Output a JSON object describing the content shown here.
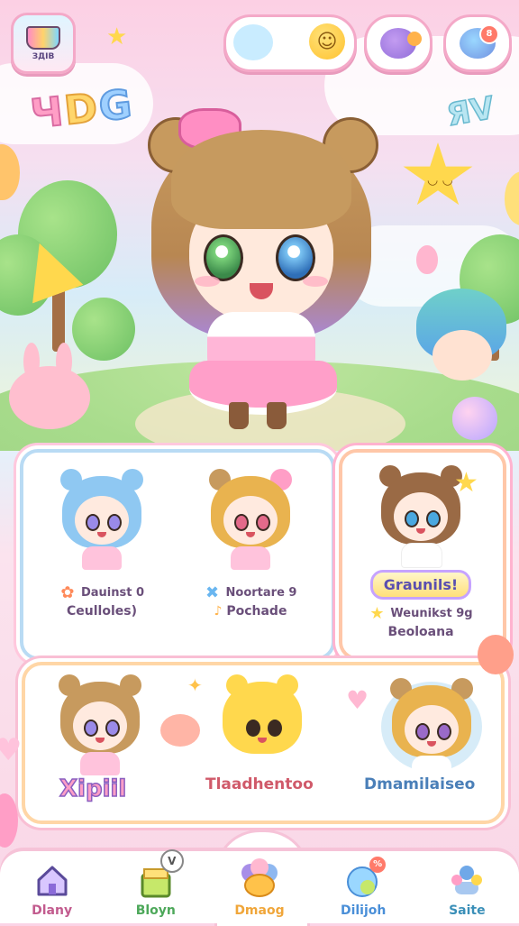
{
  "header": {
    "logo_text": "ЗДIB",
    "title_art": [
      "Ч",
      "D",
      "G"
    ],
    "deco_text": "ЯV",
    "notification_badge": "8"
  },
  "character_cards": [
    {
      "line1": "Dauinst 0",
      "line2": "Ceulloles)",
      "hair_color": "#8fc8f2"
    },
    {
      "line1": "Noortare 9",
      "line2": "Pochade",
      "hair_color": "#e9b34f"
    },
    {
      "ribbon": "Graunils!",
      "line1": "Weunikst 9g",
      "line2": "Beoloana",
      "hair_color": "#9a6a45"
    }
  ],
  "bottom_cards": [
    {
      "label": "Xipiil",
      "hair_color": "#c79a5e"
    },
    {
      "label": "Tlaadhentoo",
      "hair_color": "#ffd84d"
    },
    {
      "label": "Dmamilaiseo",
      "hair_color": "#c79a5e"
    }
  ],
  "nav": {
    "items": [
      {
        "label": "Dlany",
        "icon": "home-icon",
        "color": "#c25b8e"
      },
      {
        "label": "Bloyn",
        "icon": "gift-box-icon",
        "color": "#4da85a"
      },
      {
        "label": "Dmaog",
        "icon": "flower-icon",
        "color": "#f0a63a"
      },
      {
        "label": "Dilijoh",
        "icon": "chat-bubble-icon",
        "color": "#4a8fd8"
      },
      {
        "label": "Saite",
        "icon": "friends-icon",
        "color": "#3a8fb8"
      }
    ],
    "badge_text": "V",
    "chat_badge": "%"
  },
  "colors": {
    "accent_pink": "#f4a9c8",
    "panel_blue": "#b9dbf4",
    "panel_peach": "#ffc7a8"
  }
}
